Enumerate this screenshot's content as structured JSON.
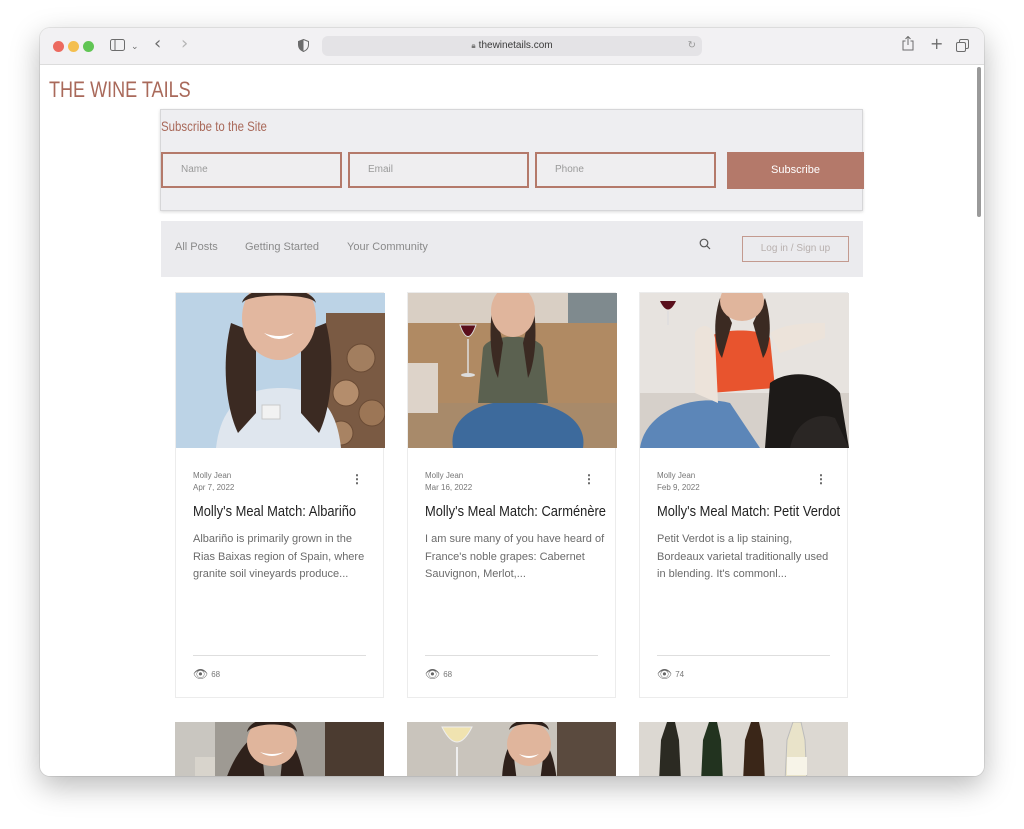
{
  "browser": {
    "url": "thewinetails.com",
    "icons": {
      "sidebar": "sidebar-icon",
      "chevron": "chevron-down-icon",
      "back": "back-icon",
      "forward": "forward-icon",
      "shield": "shield-icon",
      "lock": "lock-icon",
      "reload": "reload-icon",
      "share": "share-icon",
      "new_tab": "plus-icon",
      "tabs": "tabs-icon"
    }
  },
  "site": {
    "logo": "THE WINE TAILS",
    "brand_color": "#b4796a"
  },
  "subscribe": {
    "title": "Subscribe to the Site",
    "name_placeholder": "Name",
    "email_placeholder": "Email",
    "phone_placeholder": "Phone",
    "button": "Subscribe"
  },
  "blog_nav": {
    "items": [
      "All Posts",
      "Getting Started",
      "Your Community"
    ],
    "login": "Log in / Sign up"
  },
  "posts": [
    {
      "author": "Molly Jean",
      "date": "Apr 7, 2022",
      "title": "Molly's Meal Match: Albariño",
      "excerpt": "Albariño is primarily grown in the Rias Baixas region of Spain, where granite soil vineyards produce...",
      "views": "68"
    },
    {
      "author": "Molly Jean",
      "date": "Mar 16, 2022",
      "title": "Molly's Meal Match: Carménère",
      "excerpt": "I am sure many of you have heard of France's noble grapes: Cabernet Sauvignon, Merlot,...",
      "views": "68"
    },
    {
      "author": "Molly Jean",
      "date": "Feb 9, 2022",
      "title": "Molly's Meal Match: Petit Verdot",
      "excerpt": "Petit Verdot is a lip staining, Bordeaux varietal traditionally used in blending. It's commonl...",
      "views": "74"
    }
  ]
}
